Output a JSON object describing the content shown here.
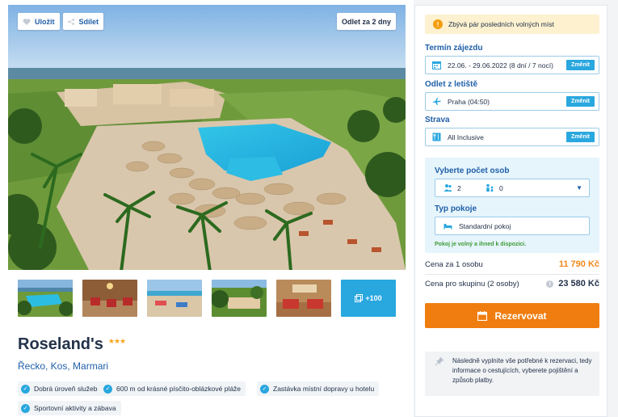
{
  "hero": {
    "save_label": "Uložit",
    "share_label": "Sdílet",
    "departure_badge": "Odlet za 2 dny"
  },
  "gallery": {
    "more_label": "+100"
  },
  "hotel": {
    "name": "Roseland's",
    "stars": 3,
    "stars_text": "★★★",
    "location": "Řecko, Kos, Marmari",
    "features": [
      "Dobrá úroveň služeb",
      "600 m od krásné písčito-oblázkové pláže",
      "Zastávka místní dopravy u hotelu",
      "Sportovní aktivity a zábava"
    ]
  },
  "booking": {
    "alert": "Zbývá pár posledních volných míst",
    "term_label": "Termín zájezdu",
    "term_value": "22.06. - 29.06.2022 (8 dní / 7 nocí)",
    "airport_label": "Odlet z letiště",
    "airport_value": "Praha (04:50)",
    "board_label": "Strava",
    "board_value": "All Inclusive",
    "change_label": "Změnit",
    "pax_label": "Vyberte počet osob",
    "adults": "2",
    "children": "0",
    "room_label": "Typ pokoje",
    "room_value": "Standardní pokoj",
    "availability": "Pokoj je volný a ihned k dispozici.",
    "price_person_label": "Cena za 1 osobu",
    "price_person_value": "11 790 Kč",
    "price_group_label": "Cena pro skupinu (2 osoby)",
    "price_group_value": "23 580 Kč",
    "book_label": "Rezervovat",
    "note": "Následně vyplníte vše potřebné k rezervaci, tedy informace o cestujících, vyberete pojištění a způsob platby."
  },
  "colors": {
    "accent": "#29a7df",
    "primary_text": "#1f5fa8",
    "cta": "#f07d0f",
    "price": "#f08a1c",
    "available": "#3d9b35"
  }
}
